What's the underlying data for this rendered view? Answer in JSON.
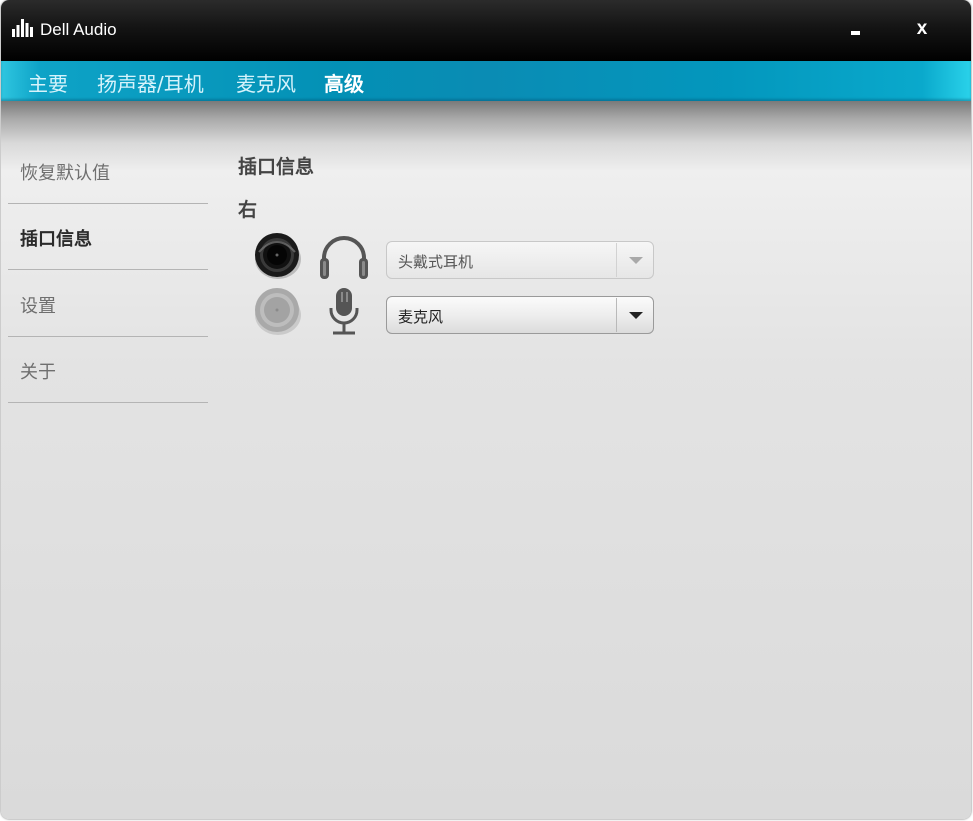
{
  "window": {
    "title": "Dell Audio",
    "minimize_icon": "minimize-icon",
    "close_label": "x"
  },
  "tabs": [
    {
      "label": "主要",
      "active": false
    },
    {
      "label": "扬声器/耳机",
      "active": false
    },
    {
      "label": "麦克风",
      "active": false
    },
    {
      "label": "高级",
      "active": true
    }
  ],
  "sidebar": {
    "items": [
      {
        "label": "恢复默认值",
        "active": false
      },
      {
        "label": "插口信息",
        "active": true
      },
      {
        "label": "设置",
        "active": false
      },
      {
        "label": "关于",
        "active": false
      }
    ]
  },
  "main": {
    "title": "插口信息",
    "side_label": "右",
    "jacks": [
      {
        "status": "connected",
        "icon": "headphones-icon",
        "device": "头戴式耳机",
        "enabled": false
      },
      {
        "status": "not-connected",
        "icon": "microphone-icon",
        "device": "麦克风",
        "enabled": true
      }
    ]
  },
  "colors": {
    "tab_bar": "#0390b5",
    "title_bar": "#000000",
    "background": "#dcdcdc"
  }
}
